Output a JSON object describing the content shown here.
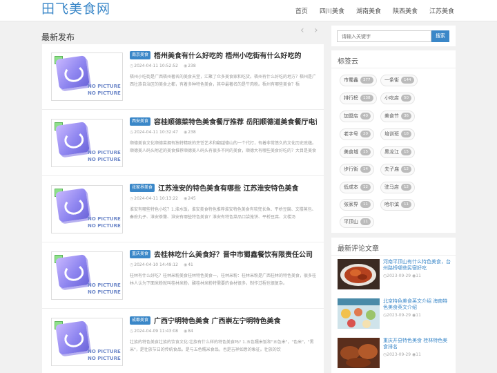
{
  "header": {
    "logo": "田飞美食网",
    "nav": [
      "首页",
      "四川美食",
      "湖南美食",
      "陕西美食",
      "江苏美食"
    ]
  },
  "main": {
    "section_title": "最新发布",
    "pager_prev": "‹",
    "pager_next": "›",
    "thumb_text_1": "NO PICTURE",
    "thumb_text_2": "NO PICTURE",
    "posts": [
      {
        "badge": "南京美食",
        "title": "梧州美食有什么好吃的 梧州小吃街有什么好吃的",
        "date": "2024-04-11 10:52:52",
        "views": "238",
        "excerpt": "梧州小吃街是广西梧州著名的美食天堂，汇聚了众多美食家和吃货。梧州有什么好吃的地方？梧州是广西壮族自治区的美食之都，有着多种特色美食，其中最著名的是牛肉粉。梧州有哪些美食？梧"
      },
      {
        "badge": "西安美食",
        "title": "容桂顺德菜特色美食餐厅推荐 岳阳顺德道美食餐厅电话",
        "date": "2024-04-11 10:32:47",
        "views": "238",
        "excerpt": "顺德美食文化顺德菜拥有独特精致的烹饪艺术和翻越德山的一个代打，有着非常悠久的文化历史底蕴。顺德美人码头附近的美食推荐顺德美人码头有很多不同的美食，顺德大有哪些美食好吃的？大目是美食"
      },
      {
        "badge": "张家界美食",
        "title": "江苏淮安的特色美食有哪些 江苏淮安特色美食",
        "date": "2024-04-11 10:13:22",
        "views": "245",
        "excerpt": "淮安有哪些特色小吃？1.淮水饭。淮安美食特色推荐淮安特色美食有软兜长鱼、平桥豆腐、文楼蒸包、秦府丸子、淮安茶馓、淮安有哪些特色美食？淮安有特色菜品口袋笼饼、平桥豆腐、文楼汤"
      },
      {
        "badge": "重庆美食",
        "title": "去桂林吃什么美食好？晋中市蜀鑫餐饮有限责任公司",
        "date": "2024-04-10 14:49:12",
        "views": "41",
        "excerpt": "桂林有什么好吃？桂林米粉美食桂林特色美食一，桂林米粉：桂林米粉是广西桂林的特色美食，很多桂林人认为下面米粉就叫桂林米粉，酸桂林米粉特需要的食材很多，制作过程也很复杂。"
      },
      {
        "badge": "成都美食",
        "title": "广西宁明特色美食 广西崇左宁明特色美食",
        "date": "2024-04-09 11:43:08",
        "views": "84",
        "excerpt": "壮族的特色美食壮族的饮食文化:壮族有什么样的特色美食吗? 1.五色糯米饭和\"五色米\"，\"色米\"，\"黑米\"，是壮族节日的传统食品。是与五色糯米食品，也是吉祥如意的象征。壮族的饮"
      }
    ]
  },
  "sidebar": {
    "search": {
      "placeholder": "请输入关键字",
      "button": "搜索"
    },
    "tags_title": "标签云",
    "tags": [
      {
        "name": "市蜀鑫",
        "count": "377"
      },
      {
        "name": "一条街",
        "count": "144"
      },
      {
        "name": "排行榜",
        "count": "138"
      },
      {
        "name": "小吃店",
        "count": "50"
      },
      {
        "name": "加盟店",
        "count": "40"
      },
      {
        "name": "美食节",
        "count": "36"
      },
      {
        "name": "老字号",
        "count": "20"
      },
      {
        "name": "培训班",
        "count": "18"
      },
      {
        "name": "美食城",
        "count": "15"
      },
      {
        "name": "黑龙江",
        "count": "15"
      },
      {
        "name": "步行街",
        "count": "14"
      },
      {
        "name": "夫子庙",
        "count": "12"
      },
      {
        "name": "低成本",
        "count": "12"
      },
      {
        "name": "驻马店",
        "count": "12"
      },
      {
        "name": "张家界",
        "count": "11"
      },
      {
        "name": "哈尔滨",
        "count": "11"
      },
      {
        "name": "平顶山",
        "count": "11"
      }
    ],
    "comments_title": "最新评论文章",
    "comments": [
      {
        "title": "河南平顶山有什么特色美食，台州路桥哪些民宿好吃",
        "date": "2023-09-29",
        "views": "11"
      },
      {
        "title": "北京特色美食英文介绍 海南特色美食英文介绍",
        "date": "2023-09-29",
        "views": "11"
      },
      {
        "title": "重庆开县特色美食 桂林特色美食排名",
        "date": "2023-09-29",
        "views": "11"
      }
    ]
  }
}
